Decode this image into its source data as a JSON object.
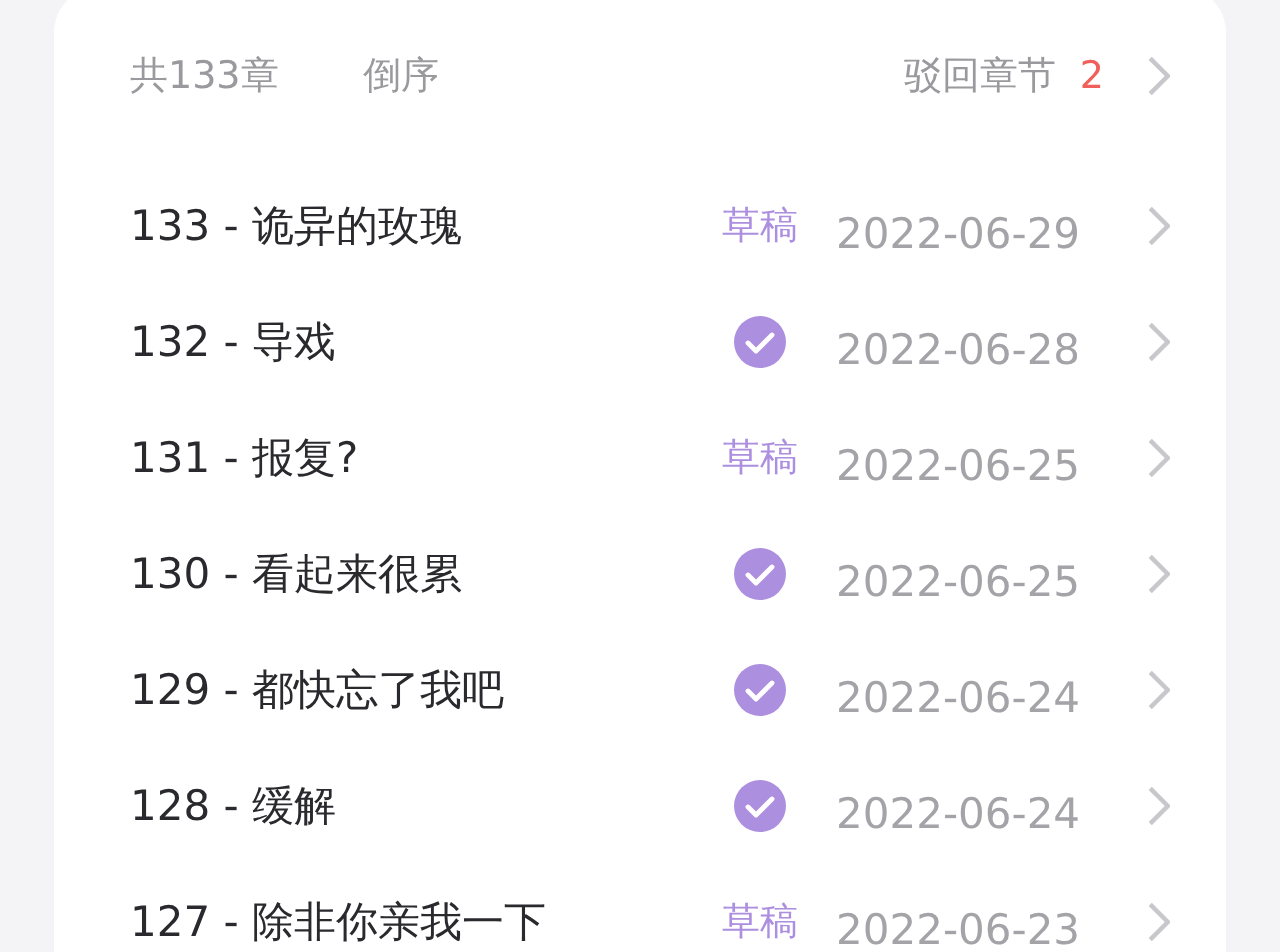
{
  "header": {
    "count": "共133章",
    "sort": "倒序",
    "rejected_label": "驳回章节",
    "rejected_count": "2"
  },
  "chapters": [
    {
      "title": "133 - 诡异的玫瑰",
      "kind": "draft",
      "status_text": "草稿",
      "date": "2022-06-29"
    },
    {
      "title": "132 - 导戏",
      "kind": "approved",
      "date": "2022-06-28"
    },
    {
      "title": "131 - 报复?",
      "kind": "draft",
      "status_text": "草稿",
      "date": "2022-06-25"
    },
    {
      "title": "130 - 看起来很累",
      "kind": "approved",
      "date": "2022-06-25"
    },
    {
      "title": "129 - 都快忘了我吧",
      "kind": "approved",
      "date": "2022-06-24"
    },
    {
      "title": "128 - 缓解",
      "kind": "approved",
      "date": "2022-06-24"
    },
    {
      "title": "127 - 除非你亲我一下",
      "kind": "draft",
      "status_text": "草稿",
      "date": "2022-06-23"
    }
  ]
}
